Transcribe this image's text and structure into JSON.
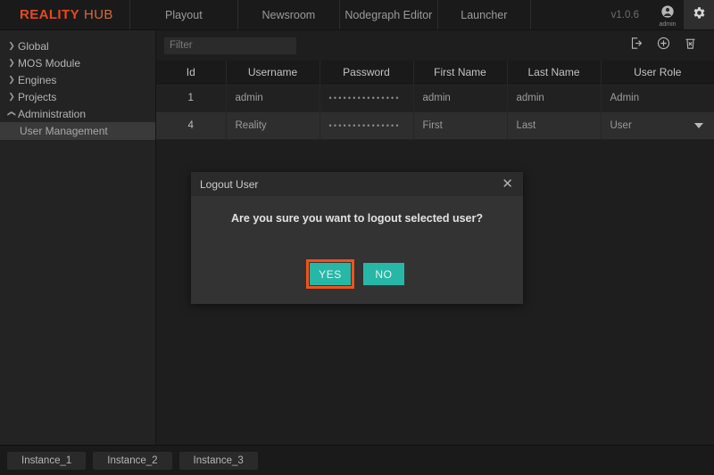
{
  "topbar": {
    "logo_primary": "REALITY",
    "logo_secondary": "HUB",
    "tabs": [
      {
        "label": "Playout"
      },
      {
        "label": "Newsroom"
      },
      {
        "label": "Nodegraph Editor"
      },
      {
        "label": "Launcher"
      }
    ],
    "version": "v1.0.6",
    "user_label": "admin",
    "icons": {
      "user": "user-avatar-icon",
      "gear": "gear-icon"
    }
  },
  "sidebar": {
    "items": [
      {
        "label": "Global",
        "expanded": false,
        "child": false
      },
      {
        "label": "MOS Module",
        "expanded": false,
        "child": false
      },
      {
        "label": "Engines",
        "expanded": false,
        "child": false
      },
      {
        "label": "Projects",
        "expanded": false,
        "child": false
      },
      {
        "label": "Administration",
        "expanded": true,
        "child": false
      },
      {
        "label": "User Management",
        "expanded": false,
        "child": true,
        "selected": true
      }
    ]
  },
  "toolbar": {
    "filter_placeholder": "Filter",
    "filter_value": "",
    "actions": [
      {
        "name": "logout-user-button"
      },
      {
        "name": "add-user-button"
      },
      {
        "name": "delete-user-button"
      }
    ]
  },
  "table": {
    "columns": [
      "Id",
      "Username",
      "Password",
      "First Name",
      "Last Name",
      "User Role"
    ],
    "rows": [
      {
        "id": "1",
        "username": "admin",
        "password": "•••••••••••••••",
        "first_name": "admin",
        "last_name": "admin",
        "user_role": "Admin",
        "selected": false,
        "role_dropdown": false
      },
      {
        "id": "4",
        "username": "Reality",
        "password": "•••••••••••••••",
        "first_name": "First",
        "last_name": "Last",
        "user_role": "User",
        "selected": true,
        "role_dropdown": true
      }
    ]
  },
  "modal": {
    "title": "Logout User",
    "message": "Are you sure you want to logout selected user?",
    "confirm_label": "YES",
    "cancel_label": "NO",
    "close_icon": "close-icon",
    "confirm_focused": true
  },
  "bottombar": {
    "instances": [
      {
        "label": "Instance_1"
      },
      {
        "label": "Instance_2"
      },
      {
        "label": "Instance_3"
      }
    ]
  },
  "colors": {
    "brand_primary": "#e8491d",
    "brand_secondary": "#d96a33",
    "accent_teal": "#27b7a7",
    "focus_ring": "#f2521b",
    "background": "#1e1e1e",
    "panel": "#232323"
  }
}
